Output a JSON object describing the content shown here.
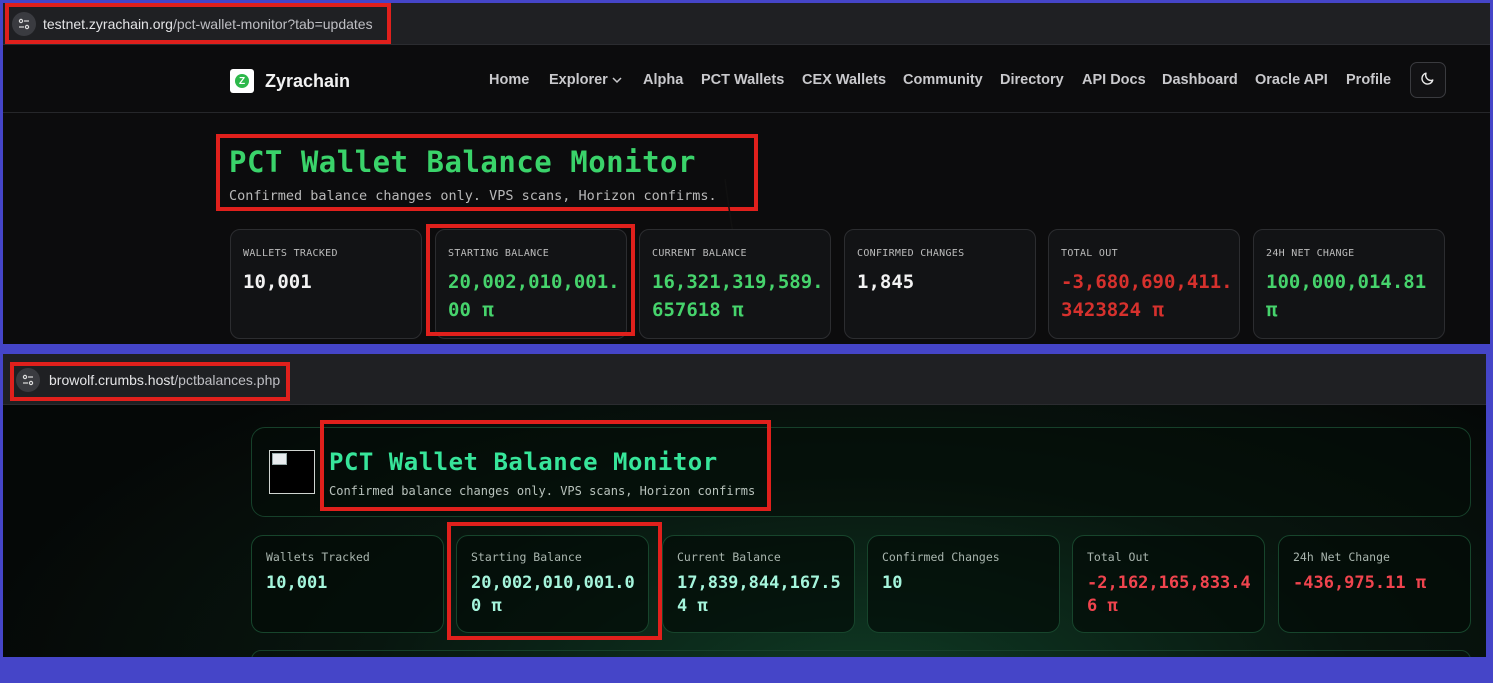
{
  "top_panel": {
    "url": {
      "host": "testnet.zyrachain.org",
      "path": "/pct-wallet-monitor?tab=updates"
    },
    "brand": "Zyrachain",
    "nav": [
      "Home",
      "Explorer",
      "Alpha",
      "PCT Wallets",
      "CEX Wallets",
      "Community",
      "Directory",
      "API Docs",
      "Dashboard",
      "Oracle API",
      "Profile"
    ],
    "title": "PCT Wallet Balance Monitor",
    "subtitle": "Confirmed balance changes only. VPS scans, Horizon confirms.",
    "cards": [
      {
        "label": "WALLETS TRACKED",
        "value": "10,001",
        "color": "#f2f2f2"
      },
      {
        "label": "STARTING BALANCE",
        "value": "20,002,010,001.00 π",
        "color": "#46d36c"
      },
      {
        "label": "CURRENT BALANCE",
        "value": "16,321,319,589.657618 π",
        "color": "#46d36c"
      },
      {
        "label": "CONFIRMED CHANGES",
        "value": "1,845",
        "color": "#f2f2f2"
      },
      {
        "label": "TOTAL OUT",
        "value": "-3,680,690,411.3423824 π",
        "color": "#d6312d"
      },
      {
        "label": "24H NET CHANGE",
        "value": "100,000,014.81 π",
        "color": "#46d36c"
      }
    ]
  },
  "bottom_panel": {
    "url": {
      "host": "browolf.crumbs.host",
      "path": "/pctbalances.php"
    },
    "title": "PCT Wallet Balance Monitor",
    "subtitle": "Confirmed balance changes only. VPS scans, Horizon confirms",
    "cards": [
      {
        "label": "Wallets Tracked",
        "value": "10,001",
        "color": "#a5f5dc"
      },
      {
        "label": "Starting Balance",
        "value": "20,002,010,001.00 π",
        "color": "#a5f5dc"
      },
      {
        "label": "Current Balance",
        "value": "17,839,844,167.54 π",
        "color": "#a5f5dc"
      },
      {
        "label": "Confirmed Changes",
        "value": "10",
        "color": "#a5f5dc"
      },
      {
        "label": "Total Out",
        "value": "-2,162,165,833.46 π",
        "color": "#f0444e"
      },
      {
        "label": "24h Net Change",
        "value": "-436,975.11 π",
        "color": "#f0444e"
      }
    ]
  },
  "colors": {
    "highlight": "#e0201c",
    "frame": "#4545c8"
  }
}
